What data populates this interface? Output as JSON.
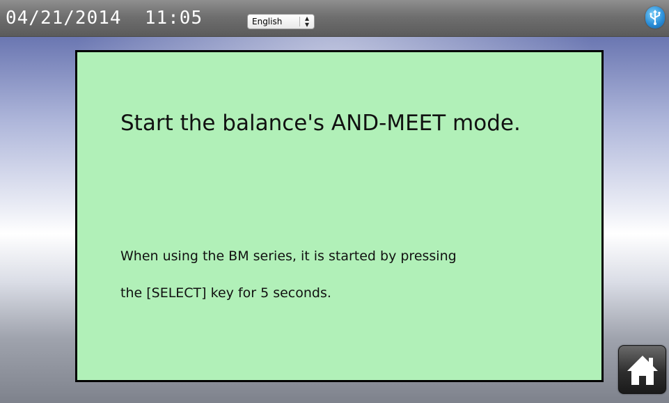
{
  "status_bar": {
    "datetime": "04/21/2014  11:05",
    "language": {
      "selected": "English",
      "arrows": "▲▼"
    },
    "usb_icon": "usb-icon"
  },
  "panel": {
    "headline": "Start the balance's AND-MEET mode.",
    "instruction_line1": "When using the BM series, it is started by pressing",
    "instruction_line2": "the [SELECT] key for 5 seconds."
  },
  "home_button": {
    "icon": "home-icon"
  },
  "colors": {
    "panel_background": "#b1f0b8",
    "panel_border": "#000000",
    "status_bar": "#6f6f6f",
    "usb_icon": "#2b8fd9"
  }
}
